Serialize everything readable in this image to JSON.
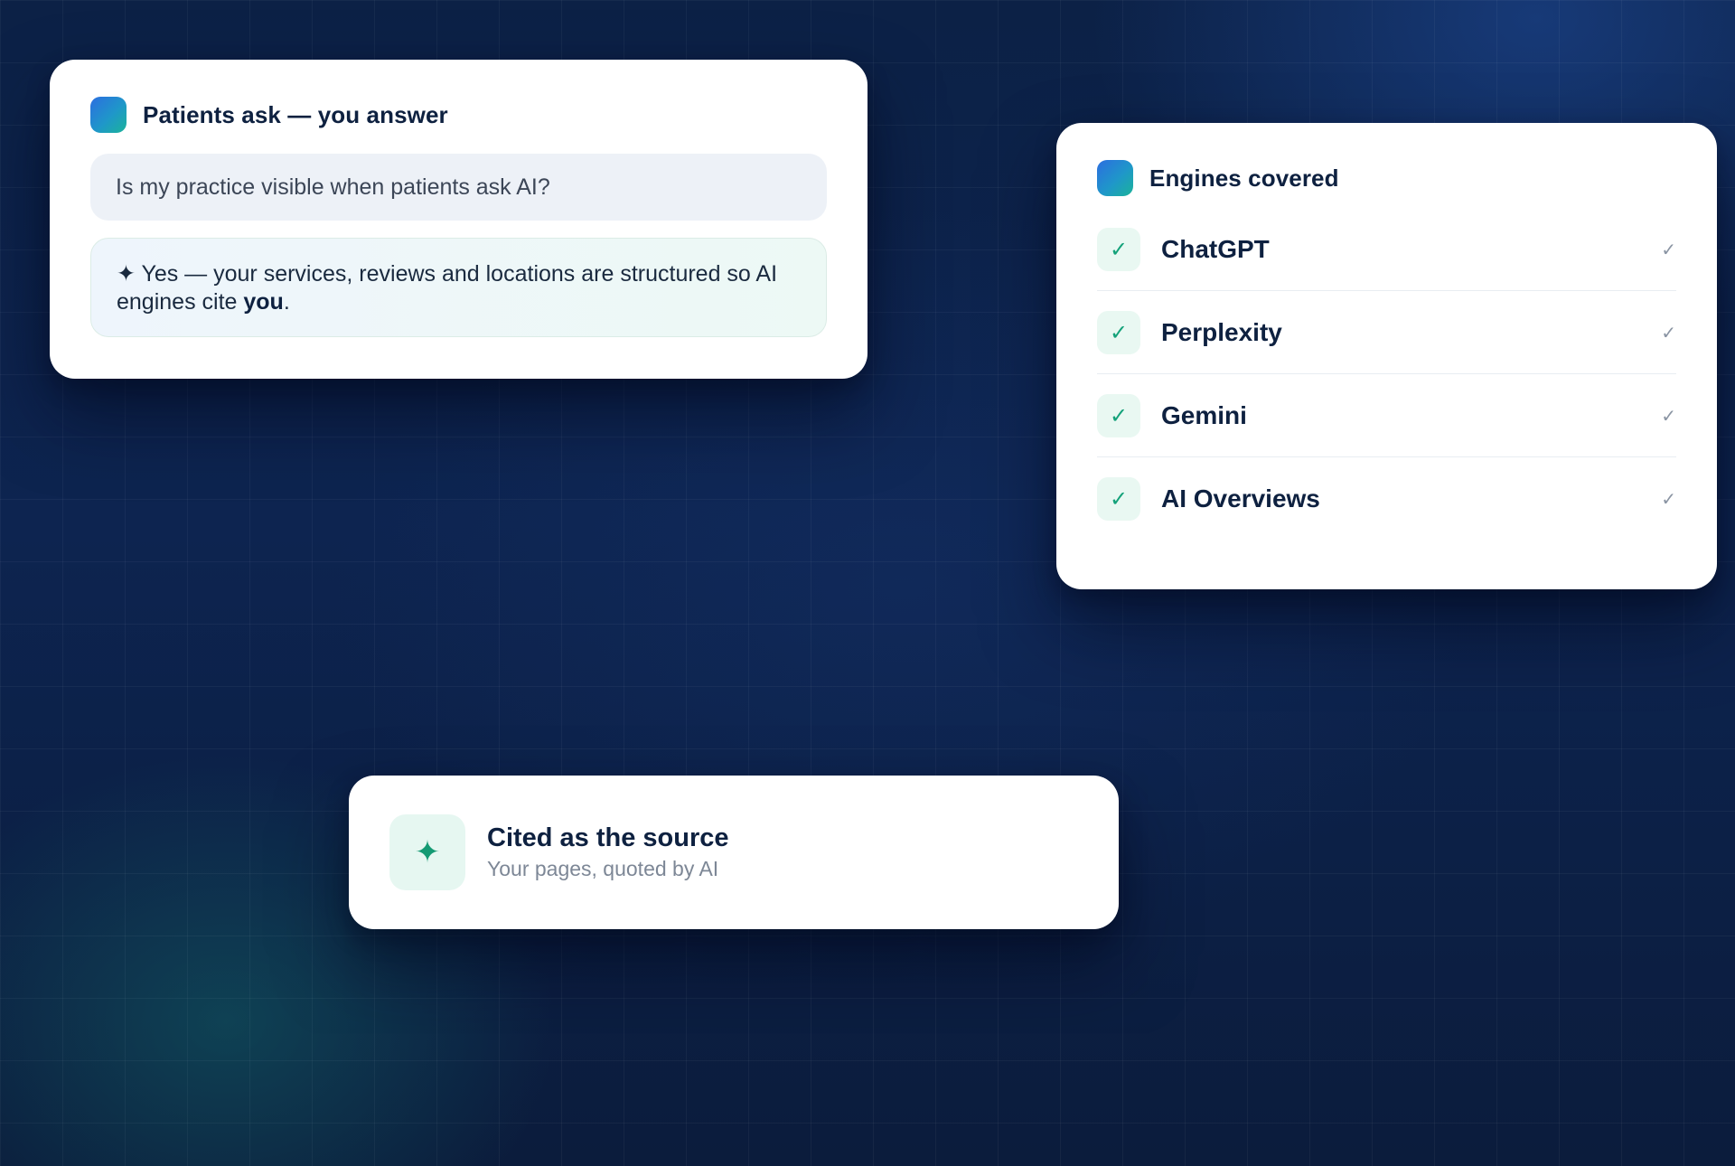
{
  "qa_card": {
    "title": "Patients ask — you answer",
    "question": "Is my practice visible when patients ask AI?",
    "answer_icon": "✦",
    "answer_text": "Yes — your services, reviews and locations are structured so AI engines cite ",
    "answer_emphasis": "you",
    "answer_end": "."
  },
  "engines_card": {
    "title": "Engines covered",
    "badge_glyph": "✓",
    "tick_glyph": "✓",
    "engines": [
      {
        "name": "ChatGPT"
      },
      {
        "name": "Perplexity"
      },
      {
        "name": "Gemini"
      },
      {
        "name": "AI Overviews"
      }
    ]
  },
  "cited_card": {
    "icon": "✦",
    "icon_name": "sparkle-icon",
    "title": "Cited as the source",
    "subtitle": "Your pages, quoted by AI"
  },
  "colors": {
    "background": "#0d2146",
    "brand_gradient_start": "#2c6ee0",
    "brand_gradient_end": "#1bb39a",
    "accent_green": "#14a27a",
    "heading": "#0e2140"
  }
}
